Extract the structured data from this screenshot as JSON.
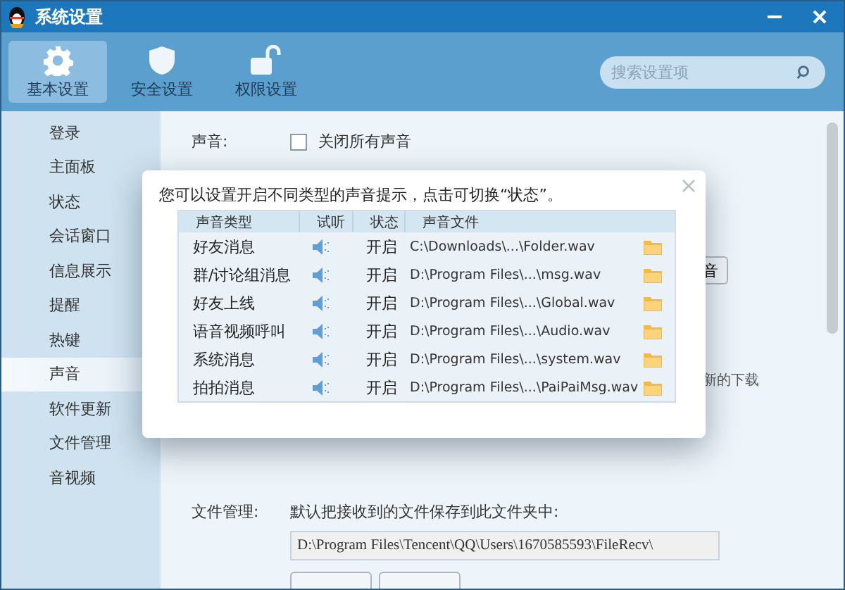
{
  "window": {
    "title": "系统设置"
  },
  "tabs": [
    {
      "label": "基本设置",
      "kind": "gear",
      "selected": true
    },
    {
      "label": "安全设置",
      "kind": "shield",
      "selected": false
    },
    {
      "label": "权限设置",
      "kind": "lock",
      "selected": false
    }
  ],
  "search": {
    "placeholder": "搜索设置项"
  },
  "sidebar": {
    "items": [
      {
        "label": "登录",
        "selected": false
      },
      {
        "label": "主面板",
        "selected": false
      },
      {
        "label": "状态",
        "selected": false
      },
      {
        "label": "会话窗口",
        "selected": false
      },
      {
        "label": "信息展示",
        "selected": false
      },
      {
        "label": "提醒",
        "selected": false
      },
      {
        "label": "热键",
        "selected": false
      },
      {
        "label": "声音",
        "selected": true
      },
      {
        "label": "软件更新",
        "selected": false
      },
      {
        "label": "文件管理",
        "selected": false
      },
      {
        "label": "音视频",
        "selected": false
      }
    ]
  },
  "sound": {
    "label": "声音:",
    "options": [
      {
        "label": "关闭所有声音",
        "checked": false
      }
    ],
    "partial_button": "音",
    "partial_text": "新的下载"
  },
  "file_management": {
    "label": "文件管理:",
    "description": "默认把接收到的文件保存到此文件夹中:",
    "path": "D:\\Program Files\\Tencent\\QQ\\Users\\1670585593\\FileRecv\\"
  },
  "dialog": {
    "message": "您可以设置开启不同类型的声音提示，点击可切换“状态”。",
    "columns": [
      "声音类型",
      "试听",
      "状态",
      "声音文件"
    ],
    "rows": [
      {
        "type": "好友消息",
        "status": "开启",
        "file": "C:\\Downloads\\...\\Folder.wav"
      },
      {
        "type": "群/讨论组消息",
        "status": "开启",
        "file": "D:\\Program Files\\...\\msg.wav"
      },
      {
        "type": "好友上线",
        "status": "开启",
        "file": "D:\\Program Files\\...\\Global.wav"
      },
      {
        "type": "语音视频呼叫",
        "status": "开启",
        "file": "D:\\Program Files\\...\\Audio.wav"
      },
      {
        "type": "系统消息",
        "status": "开启",
        "file": "D:\\Program Files\\...\\system.wav"
      },
      {
        "type": "拍拍消息",
        "status": "开启",
        "file": "D:\\Program Files\\...\\PaiPaiMsg.wav"
      }
    ]
  }
}
